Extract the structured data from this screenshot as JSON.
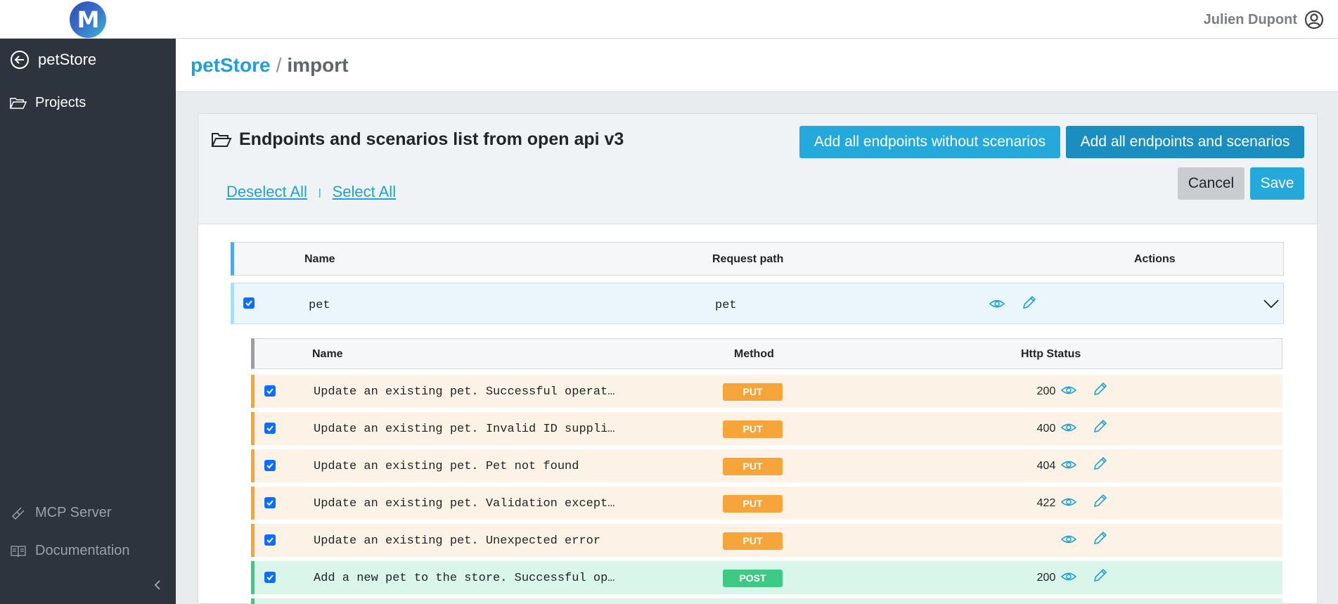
{
  "topbar": {
    "logo_letter": "M",
    "user_name": "Julien Dupont"
  },
  "sidebar": {
    "back_label": "petStore",
    "items": [
      {
        "label": "Projects"
      },
      {
        "label": "MCP Server"
      },
      {
        "label": "Documentation"
      }
    ]
  },
  "breadcrumb": {
    "project": "petStore",
    "separator": "/",
    "current": "import"
  },
  "card": {
    "title": "Endpoints and scenarios list from open api v3",
    "deselect_all": "Deselect All",
    "separator": "|",
    "select_all": "Select All",
    "buttons": {
      "add_without": "Add all endpoints without scenarios",
      "add_all": "Add all endpoints and scenarios",
      "cancel": "Cancel",
      "save": "Save"
    }
  },
  "endpoints_table": {
    "headers": {
      "name": "Name",
      "path": "Request path",
      "actions": "Actions"
    },
    "rows": [
      {
        "name": "pet",
        "path": "pet",
        "checked": true
      }
    ]
  },
  "scenarios_table": {
    "headers": {
      "name": "Name",
      "method": "Method",
      "status": "Http Status"
    },
    "rows": [
      {
        "name": "Update an existing pet. Successful operat…",
        "method": "PUT",
        "status": "200",
        "checked": true
      },
      {
        "name": "Update an existing pet. Invalid ID suppli…",
        "method": "PUT",
        "status": "400",
        "checked": true
      },
      {
        "name": "Update an existing pet. Pet not found",
        "method": "PUT",
        "status": "404",
        "checked": true
      },
      {
        "name": "Update an existing pet. Validation except…",
        "method": "PUT",
        "status": "422",
        "checked": true
      },
      {
        "name": "Update an existing pet. Unexpected error",
        "method": "PUT",
        "status": "",
        "checked": true
      },
      {
        "name": "Add a new pet to the store. Successful op…",
        "method": "POST",
        "status": "200",
        "checked": true
      }
    ]
  },
  "colors": {
    "accent": "#1ea1d6",
    "sidebar_bg": "#2d343e",
    "put": "#f6a53a",
    "post": "#3ec985"
  }
}
